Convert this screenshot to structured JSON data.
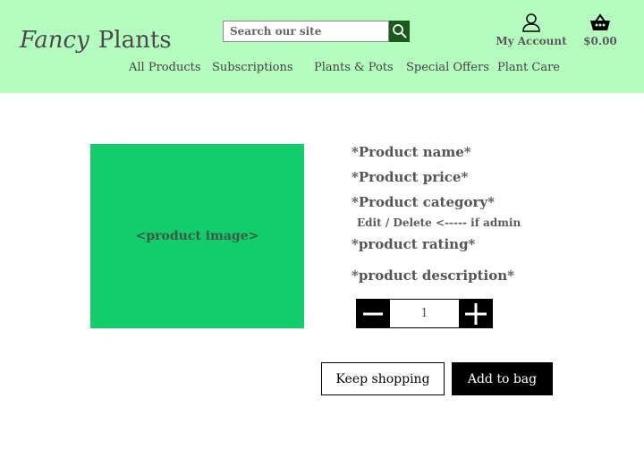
{
  "header": {
    "logo_word1": "Fancy",
    "logo_word2": "Plants",
    "search": {
      "placeholder": "Search our site",
      "icon": "search-icon"
    },
    "account": {
      "label": "My Account",
      "icon": "user-icon"
    },
    "basket": {
      "total": "$0.00",
      "icon": "basket-icon"
    },
    "background": "#b4fdbf"
  },
  "nav": {
    "all_products": "All Products",
    "subscriptions": "Subscriptions",
    "plants_pots": "Plants & Pots",
    "special_offers": "Special Offers",
    "plant_care": "Plant Care"
  },
  "product": {
    "image_placeholder": "<product image>",
    "image_color": "#13cc6b",
    "name": "*Product name*",
    "price": "*Product price*",
    "category": "*Product category*",
    "admin": {
      "edit": "Edit",
      "separator": "/",
      "delete": "Delete",
      "note": "<----- if admin"
    },
    "rating": "*product rating*",
    "description": "*product description*"
  },
  "quantity": {
    "value": "1",
    "decrement_icon": "minus-icon",
    "increment_icon": "plus-icon"
  },
  "actions": {
    "keep_shopping": "Keep shopping",
    "add_to_bag": "Add to bag"
  }
}
